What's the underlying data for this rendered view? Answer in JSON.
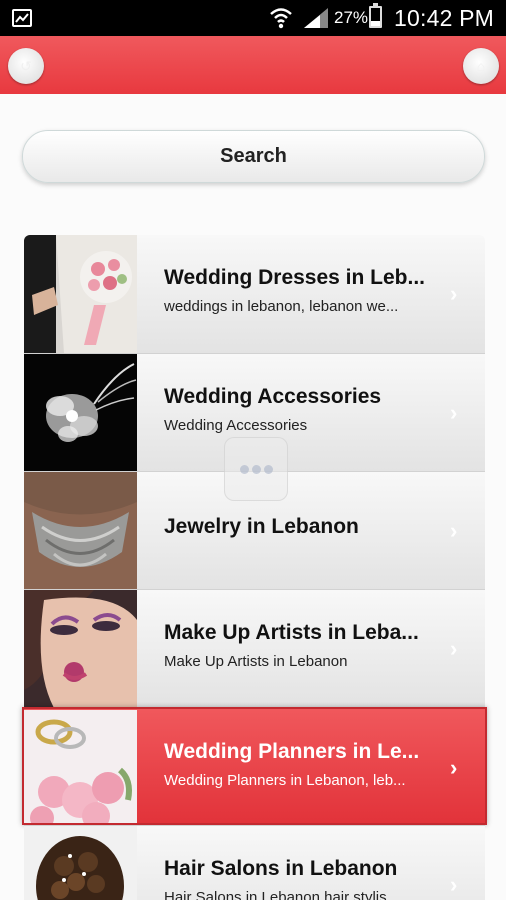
{
  "status_bar": {
    "battery_percent": "27%",
    "time": "10:42 PM"
  },
  "toolbar": {
    "back_icon": "back-icon",
    "home_icon": "home-icon"
  },
  "search": {
    "label": "Search"
  },
  "categories": [
    {
      "title": "Wedding Dresses in Leb...",
      "subtitle": "weddings in lebanon, lebanon we...",
      "selected": false
    },
    {
      "title": "Wedding Accessories",
      "subtitle": "Wedding Accessories",
      "selected": false
    },
    {
      "title": "Jewelry in Lebanon",
      "subtitle": "",
      "selected": false
    },
    {
      "title": "Make Up Artists in Leba...",
      "subtitle": "Make Up Artists in Lebanon",
      "selected": false
    },
    {
      "title": "Wedding Planners in Le...",
      "subtitle": "Wedding Planners in Lebanon, leb...",
      "selected": true
    },
    {
      "title": "Hair Salons in Lebanon",
      "subtitle": "Hair Salons in Lebanon hair stylis...",
      "selected": false
    }
  ],
  "colors": {
    "accent": "#e8393f",
    "selected_row": "#e2333a"
  }
}
